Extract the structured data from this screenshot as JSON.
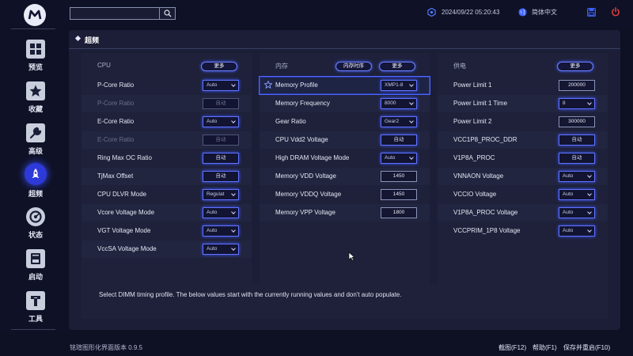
{
  "topbar": {
    "search_placeholder": "",
    "datetime": "2024/09/22 05:20:43",
    "language": "简体中文"
  },
  "sidebar": {
    "items": [
      {
        "label": "预览",
        "icon": "grid-icon"
      },
      {
        "label": "收藏",
        "icon": "star-icon"
      },
      {
        "label": "高级",
        "icon": "wrench-icon"
      },
      {
        "label": "超频",
        "icon": "rocket-icon",
        "active": true
      },
      {
        "label": "状态",
        "icon": "gauge-icon"
      },
      {
        "label": "启动",
        "icon": "ssd-icon"
      },
      {
        "label": "工具",
        "icon": "tools-icon"
      }
    ]
  },
  "section": {
    "title": "超频"
  },
  "columns": {
    "cpu": {
      "title": "CPU",
      "more": "更多",
      "rows": [
        {
          "label": "P-Core Ratio",
          "value": "Auto"
        },
        {
          "label": "P-Core Ratio",
          "value": "自动"
        },
        {
          "label": "E-Core Ratio",
          "value": "Auto"
        },
        {
          "label": "E-Core Ratio",
          "value": "自动"
        },
        {
          "label": "Ring Max OC Ratio",
          "value": "自动"
        },
        {
          "label": "TjMax Offset",
          "value": "自动"
        },
        {
          "label": "CPU DLVR Mode",
          "value": "Regulat"
        },
        {
          "label": "Vcore Voltage Mode",
          "value": "Auto"
        },
        {
          "label": "VGT Voltage Mode",
          "value": "Auto"
        },
        {
          "label": "VccSA Voltage Mode",
          "value": "Auto"
        }
      ]
    },
    "memory": {
      "title": "内存",
      "timing": "内存时序",
      "more": "更多",
      "rows": [
        {
          "label": "Memory Profile",
          "value": "XMP1-8"
        },
        {
          "label": "Memory Frequency",
          "value": "8000"
        },
        {
          "label": "Gear Ratio",
          "value": "Gear2"
        },
        {
          "label": "CPU Vdd2 Voltage",
          "value": "自动"
        },
        {
          "label": "High DRAM Voltage Mode",
          "value": "Auto"
        },
        {
          "label": "Memory VDD Voltage",
          "value": "1450"
        },
        {
          "label": "Memory VDDQ Voltage",
          "value": "1450"
        },
        {
          "label": "Memory VPP Voltage",
          "value": "1800"
        }
      ]
    },
    "power": {
      "title": "供电",
      "more": "更多",
      "rows": [
        {
          "label": "Power Limit 1",
          "value": "200000"
        },
        {
          "label": "Power Limit 1 Time",
          "value": "8"
        },
        {
          "label": "Power Limit 2",
          "value": "300000"
        },
        {
          "label": "VCC1P8_PROC_DDR",
          "value": "自动"
        },
        {
          "label": "V1P8A_PROC",
          "value": "自动"
        },
        {
          "label": "VNNAON Voltage",
          "value": "Auto"
        },
        {
          "label": "VCCIO Voltage",
          "value": "Auto"
        },
        {
          "label": "V1P8A_PROC Voltage",
          "value": "Auto"
        },
        {
          "label": "VCCPRIM_1P8 Voltage",
          "value": "Auto"
        }
      ]
    }
  },
  "help": {
    "text": "Select DIMM timing profile. The below values start with the currently running values and don't auto populate."
  },
  "footer": {
    "version": "铭瑄图形化界面版本 0.9.5",
    "screenshot": "截图(F12)",
    "help": "帮助(F1)",
    "save_restart": "保存并重启(F10)"
  },
  "colors": {
    "accent": "#5f73ff",
    "background": "#0e1024",
    "panel": "#1b1e36"
  }
}
